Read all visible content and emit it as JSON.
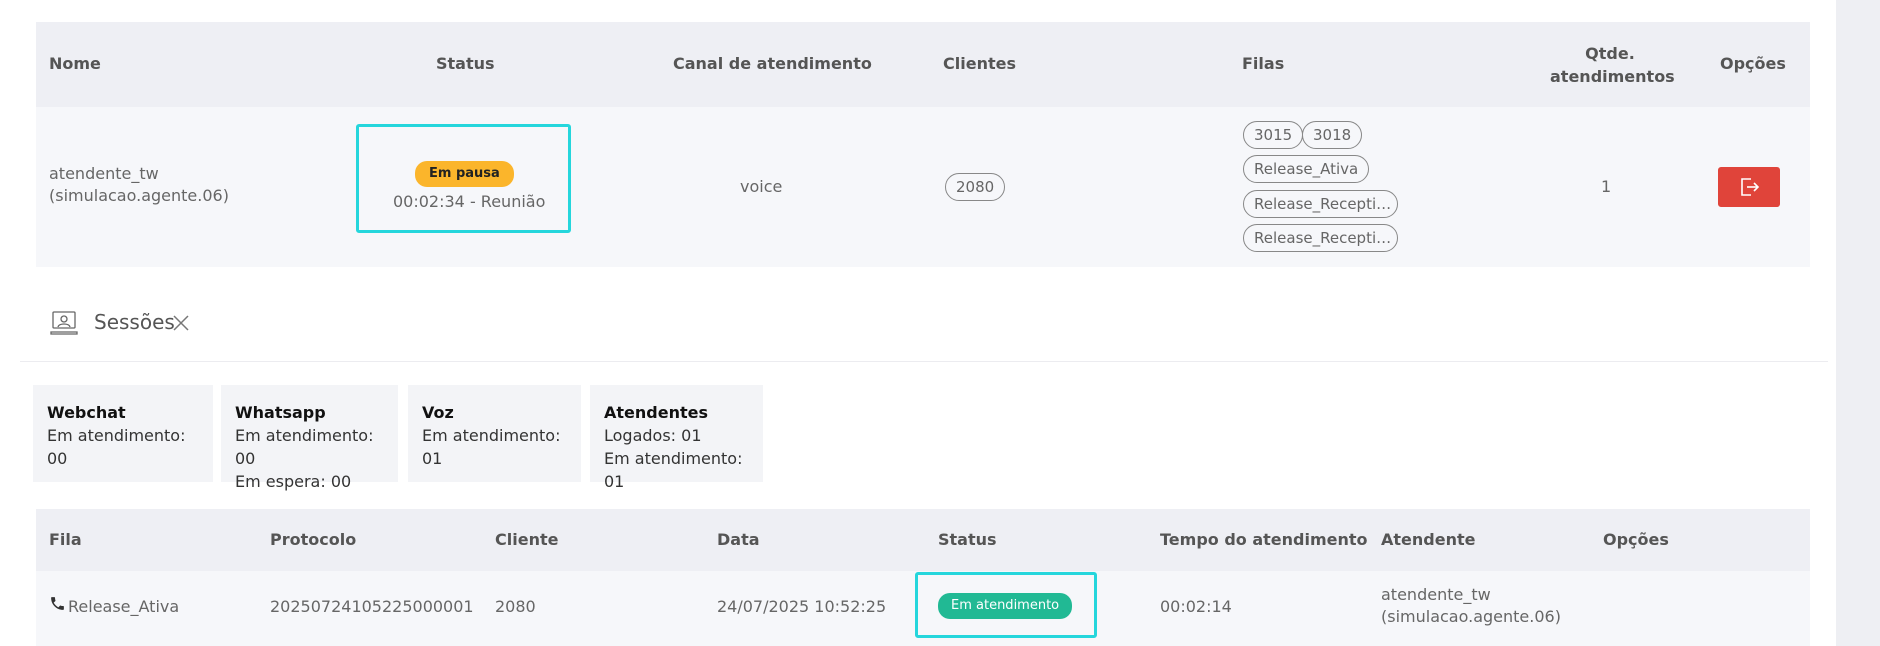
{
  "agents_table": {
    "headers": {
      "name": "Nome",
      "status": "Status",
      "channel": "Canal de atendimento",
      "clients": "Clientes",
      "queues": "Filas",
      "count_line1": "Qtde.",
      "count_line2": "atendimentos",
      "options": "Opções"
    },
    "row": {
      "name_line1": "atendente_tw",
      "name_line2": "(simulacao.agente.06)",
      "status_badge": "Em pausa",
      "status_detail": "00:02:34 - Reunião",
      "channel": "voice",
      "client": "2080",
      "queues": [
        "3015",
        "3018",
        "Release_Ativa",
        "Release_Recepti…",
        "Release_Recepti…"
      ],
      "count": "1"
    }
  },
  "sessions": {
    "title": "Sessões",
    "cards": [
      {
        "title": "Webchat",
        "lines": [
          "Em atendimento: 00"
        ]
      },
      {
        "title": "Whatsapp",
        "lines": [
          "Em atendimento: 00",
          "Em espera: 00"
        ]
      },
      {
        "title": "Voz",
        "lines": [
          "Em atendimento: 01"
        ]
      },
      {
        "title": "Atendentes",
        "lines": [
          "Logados: 01",
          "Em atendimento: 01"
        ]
      }
    ],
    "table": {
      "headers": {
        "queue": "Fila",
        "protocol": "Protocolo",
        "client": "Cliente",
        "date": "Data",
        "status": "Status",
        "duration": "Tempo do atendimento",
        "agent": "Atendente",
        "options": "Opções"
      },
      "row": {
        "queue": "Release_Ativa",
        "protocol": "20250724105225000001",
        "client": "2080",
        "date": "24/07/2025 10:52:25",
        "status": "Em atendimento",
        "duration": "00:02:14",
        "agent_line1": "atendente_tw",
        "agent_line2": "(simulacao.agente.06)"
      }
    }
  },
  "colors": {
    "pause_badge": "#fbb52b",
    "active_badge": "#21b994",
    "exit_button": "#e0443a",
    "highlight": "#25d6dc"
  },
  "icons": [
    "sessions-icon",
    "close-icon",
    "exit-icon",
    "phone-icon"
  ]
}
